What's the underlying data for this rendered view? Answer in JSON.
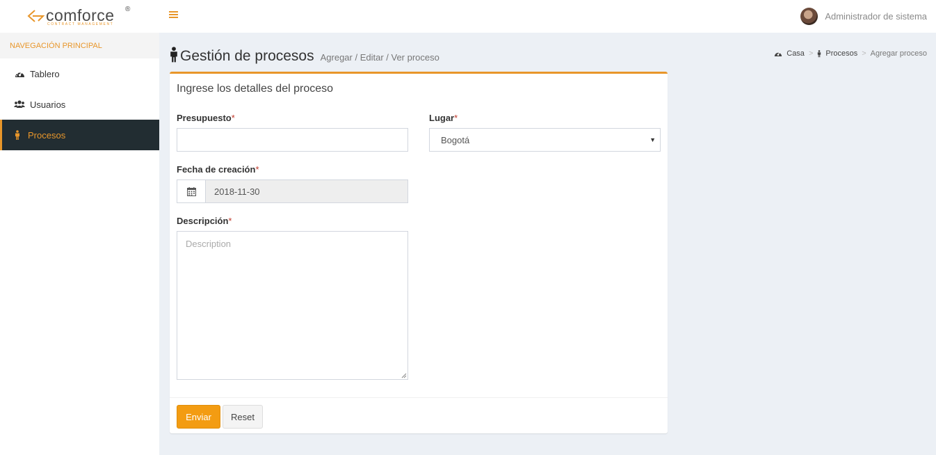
{
  "header": {
    "logo_word": "comforce",
    "logo_mark": "®",
    "logo_tagline": "CONTRACT MANAGEMENT",
    "menu_icon": "hamburger-icon",
    "user_name": "Administrador de sistema"
  },
  "sidebar": {
    "header": "NAVEGACIÓN PRINCIPAL",
    "items": [
      {
        "label": "Tablero",
        "icon": "dashboard-icon",
        "active": false
      },
      {
        "label": "Usuarios",
        "icon": "users-icon",
        "active": false
      },
      {
        "label": "Procesos",
        "icon": "person-icon",
        "active": true
      }
    ]
  },
  "page": {
    "title": "Gestión de procesos",
    "subtitle": "Agregar / Editar / Ver proceso"
  },
  "breadcrumb": {
    "home": "Casa",
    "section": "Procesos",
    "current": "Agregar proceso"
  },
  "form": {
    "title": "Ingrese los detalles del proceso",
    "budget": {
      "label": "Presupuesto",
      "required": "*",
      "value": ""
    },
    "location": {
      "label": "Lugar",
      "required": "*",
      "value": "Bogotá"
    },
    "date": {
      "label": "Fecha de creación",
      "required": "*",
      "value": "2018-11-30"
    },
    "description": {
      "label": "Descripción",
      "required": "*",
      "placeholder": "Description"
    },
    "submit_label": "Enviar",
    "reset_label": "Reset"
  },
  "colors": {
    "accent": "#e8962a",
    "button": "#f39c12",
    "sidebar_active": "#222d32",
    "background": "#ecf0f5"
  }
}
